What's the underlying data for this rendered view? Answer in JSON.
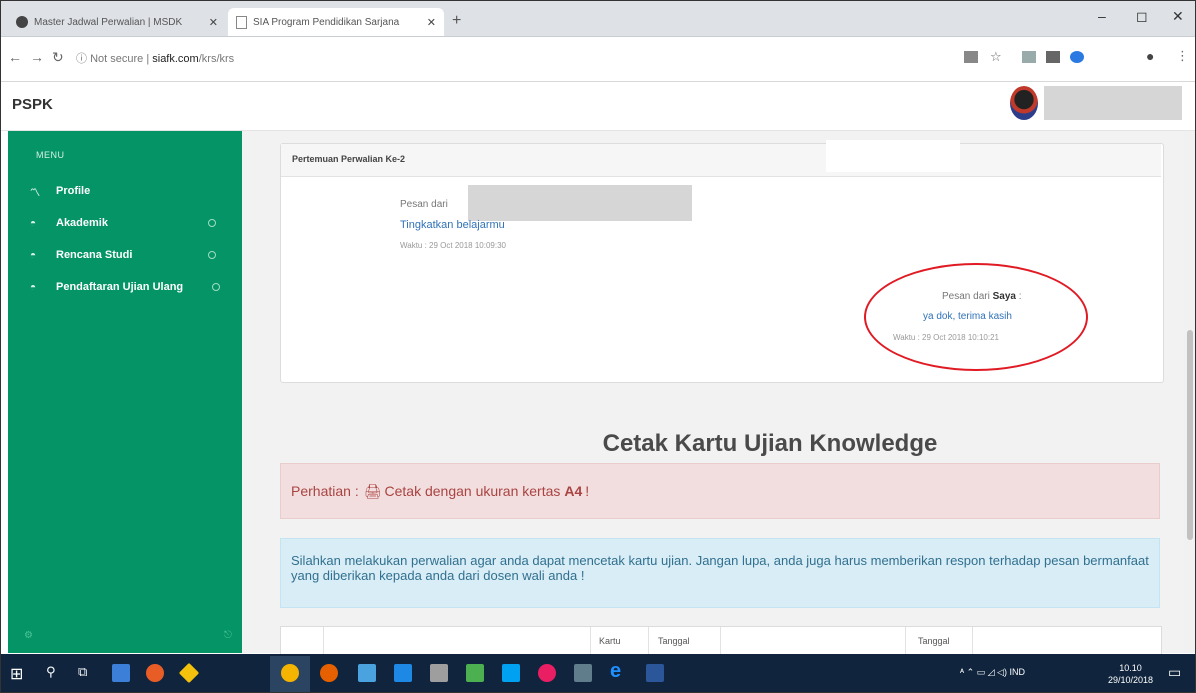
{
  "browser": {
    "tabs": [
      {
        "label": "Master Jadwal Perwalian | MSDK",
        "active": false
      },
      {
        "label": "SIA Program Pendidikan Sarjana",
        "active": true
      }
    ],
    "new_tab": "+",
    "window_controls": [
      "–",
      "◻",
      "✕"
    ],
    "security": "Not secure",
    "url_domain": "siafk.com",
    "url_path": "/krs/krs"
  },
  "app": {
    "brand": "PSPK"
  },
  "sidebar": {
    "header": "MENU",
    "items": [
      {
        "label": "Profile",
        "icon": "chart-icon"
      },
      {
        "label": "Akademik",
        "icon": "cap-icon",
        "expandable": true
      },
      {
        "label": "Rencana Studi",
        "icon": "cap-icon",
        "expandable": true
      },
      {
        "label": "Pendaftaran Ujian Ulang",
        "icon": "cap-icon",
        "expandable": true
      }
    ]
  },
  "panel": {
    "title": "Pertemuan Perwalian Ke-2",
    "message1": {
      "from": "Pesan dari",
      "text": "Tingkatkan belajarmu",
      "time": "Waktu : 29 Oct 2018 10:09:30"
    },
    "message2": {
      "from_prefix": "Pesan dari",
      "from_name": "Saya",
      "from_suffix": ":",
      "text": "ya dok, terima kasih",
      "time": "Waktu : 29 Oct 2018 10:10:21"
    }
  },
  "cetak": {
    "title": "Cetak Kartu Ujian Knowledge",
    "alert_prefix": "Perhatian :",
    "alert_icon": "printer-icon",
    "alert_text": "Cetak dengan ukuran kertas",
    "alert_bold": "A4",
    "alert_suffix": "!",
    "info": "Silahkan melakukan perwalian agar anda dapat mencetak kartu ujian. Jangan lupa, anda juga harus memberikan respon terhadap pesan bermanfaat yang diberikan kepada anda dari dosen wali anda !"
  },
  "table": {
    "headers": [
      "Kartu",
      "Tanggal",
      "Tanggal"
    ]
  },
  "taskbar": {
    "tray": "ᴬ  ⌃  ▭  ◿  ◁)  IND",
    "time": "10.10",
    "date": "29/10/2018"
  },
  "colors": {
    "sidebar": "#049465",
    "alert_danger_bg": "#f2dede",
    "alert_info_bg": "#d9edf7",
    "link": "#3172b8",
    "annotation_circle": "#e01b24"
  }
}
